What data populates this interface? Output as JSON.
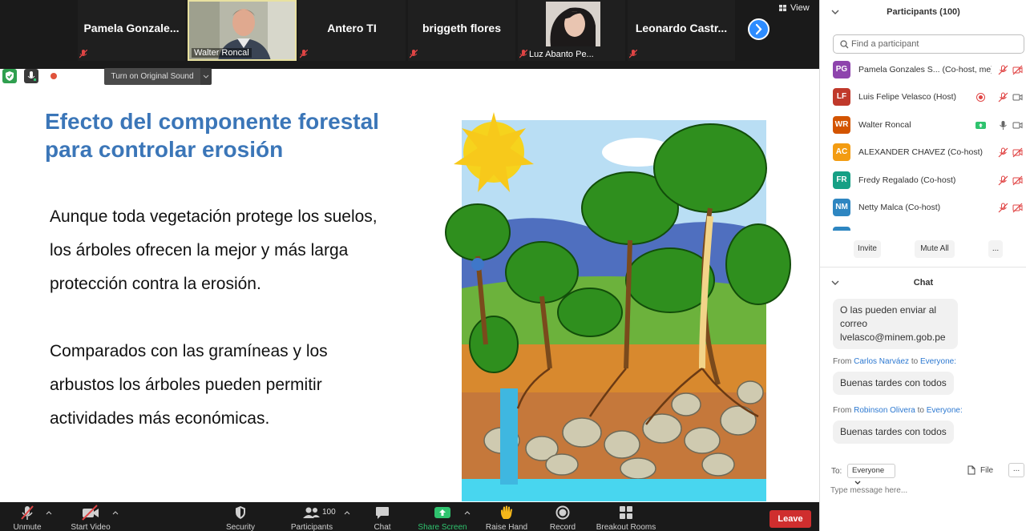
{
  "gallery": {
    "tiles": [
      {
        "name": "Pamela  Gonzale...",
        "type": "name"
      },
      {
        "name": "Walter Roncal",
        "type": "video"
      },
      {
        "name": "Antero TI",
        "type": "name"
      },
      {
        "name": "briggeth flores",
        "type": "name"
      },
      {
        "name": "Luz Abanto Pe...",
        "type": "video"
      },
      {
        "name": "Leonardo  Castr...",
        "type": "name"
      }
    ],
    "view_label": "View"
  },
  "audio": {
    "original_sound_label": "Turn on Original Sound"
  },
  "slide": {
    "title_line1": "Efecto del componente forestal",
    "title_line2": "para controlar erosión",
    "para1": "Aunque toda vegetación protege los suelos, los árboles ofrecen la mejor y más larga protección contra la erosión.",
    "para2": "Comparados con las gramíneas y los arbustos los árboles pueden permitir actividades más económicas."
  },
  "toolbar": {
    "unmute": "Unmute",
    "start_video": "Start Video",
    "security": "Security",
    "participants": "Participants",
    "participants_count": "100",
    "chat": "Chat",
    "share_screen": "Share Screen",
    "raise_hand": "Raise Hand",
    "record": "Record",
    "breakout_rooms": "Breakout Rooms",
    "leave": "Leave"
  },
  "participants_panel": {
    "title": "Participants (100)",
    "search_placeholder": "Find a participant",
    "list": [
      {
        "initials": "PG",
        "color": "#8e44ad",
        "name": "Pamela Gonzales S...",
        "role": "(Co-host, me)"
      },
      {
        "initials": "LF",
        "color": "#c0392b",
        "name": "Luis Felipe Velasco",
        "role": "(Host)"
      },
      {
        "initials": "WR",
        "color": "#d35400",
        "name": "Walter Roncal",
        "role": ""
      },
      {
        "initials": "AC",
        "color": "#f39c12",
        "name": "ALEXANDER CHAVEZ",
        "role": "(Co-host)"
      },
      {
        "initials": "FR",
        "color": "#16a085",
        "name": "Fredy Regalado",
        "role": "(Co-host)"
      },
      {
        "initials": "NM",
        "color": "#2e86c1",
        "name": "Netty Malca",
        "role": "(Co-host)"
      }
    ],
    "invite": "Invite",
    "mute_all": "Mute All",
    "more": "..."
  },
  "chat_panel": {
    "title": "Chat",
    "messages": [
      {
        "from": "",
        "to": "",
        "text": "O las pueden enviar al correo lvelasco@minem.gob.pe"
      },
      {
        "from": "Carlos Narváez",
        "to": "Everyone:",
        "text": "Buenas tardes con todos"
      },
      {
        "from": "Robinson Olivera",
        "to": "Everyone:",
        "text": "Buenas tardes con todos"
      }
    ],
    "from_word": "From",
    "to_word": "to",
    "to_label": "To:",
    "to_value": "Everyone",
    "file_label": "File",
    "more_label": "...",
    "message_placeholder": "Type message here..."
  }
}
